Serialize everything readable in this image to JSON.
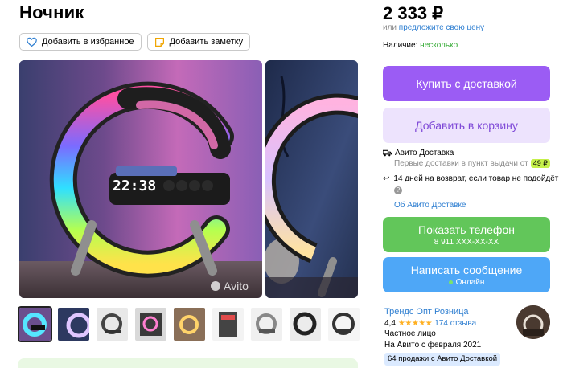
{
  "product": {
    "title": "Ночник",
    "add_favorite": "Добавить в избранное",
    "add_note": "Добавить заметку",
    "watermark": "Avito",
    "clock_text": "22:38"
  },
  "gallery": {
    "thumb_count": 9,
    "active_index": 0
  },
  "price": {
    "value": "2 333 ₽",
    "or_text": "или",
    "suggest_link": "предложите свою цену",
    "availability_label": "Наличие:",
    "availability_value": "несколько"
  },
  "buttons": {
    "buy": "Купить с доставкой",
    "cart": "Добавить в корзину",
    "phone": "Показать телефон",
    "phone_sub": "8 911 XXX-XX-XX",
    "message": "Написать сообщение",
    "message_sub": "Онлайн"
  },
  "delivery": {
    "title": "Авито Доставка",
    "sub": "Первые доставки в пункт выдачи от",
    "price_badge": "49 ₽",
    "return_text": "14 дней на возврат, если товар не подойдёт",
    "help": "?",
    "about_link": "Об Авито Доставке"
  },
  "seller": {
    "name": "Трендс Опт Розница",
    "rating": "4,4",
    "stars": "★★★★★",
    "reviews": "174 отзыва",
    "type": "Частное лицо",
    "since": "На Авито с февраля 2021",
    "sales_badge": "64 продажи с Авито Доставкой"
  },
  "colors": {
    "buy": "#9b5cf4",
    "cart_bg": "#ede3fd",
    "phone": "#62c65a",
    "message": "#4ea7f7",
    "link": "#2f7fd1",
    "green_text": "#33aa33"
  }
}
